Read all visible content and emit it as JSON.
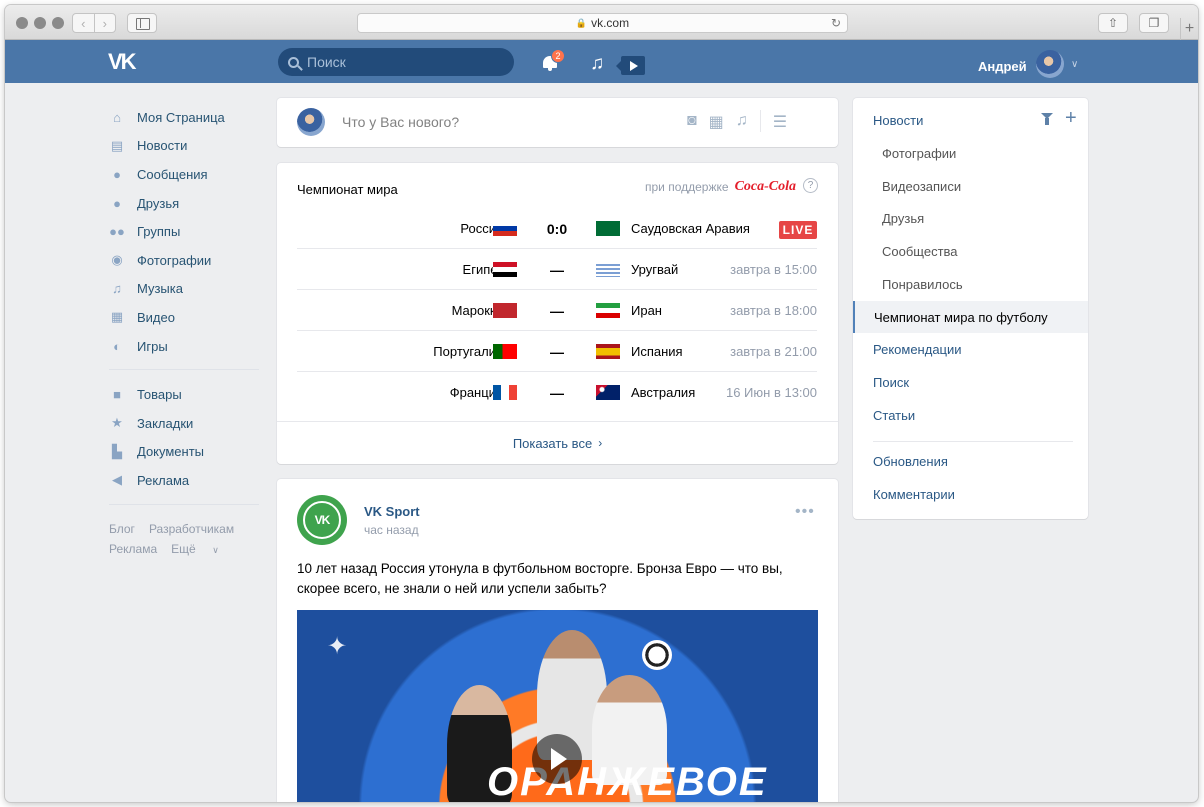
{
  "browser": {
    "url": "vk.com"
  },
  "header": {
    "search_placeholder": "Поиск",
    "notifications_count": "2",
    "user_name": "Андрей"
  },
  "left_menu": {
    "items": [
      {
        "label": "Моя Страница",
        "icon": "home-icon"
      },
      {
        "label": "Новости",
        "icon": "news-icon"
      },
      {
        "label": "Сообщения",
        "icon": "messages-icon"
      },
      {
        "label": "Друзья",
        "icon": "friends-icon"
      },
      {
        "label": "Группы",
        "icon": "groups-icon"
      },
      {
        "label": "Фотографии",
        "icon": "camera-icon"
      },
      {
        "label": "Музыка",
        "icon": "music-icon"
      },
      {
        "label": "Видео",
        "icon": "video-icon"
      },
      {
        "label": "Игры",
        "icon": "gamepad-icon"
      }
    ],
    "items2": [
      {
        "label": "Товары",
        "icon": "bag-icon"
      },
      {
        "label": "Закладки",
        "icon": "star-icon"
      },
      {
        "label": "Документы",
        "icon": "document-icon"
      },
      {
        "label": "Реклама",
        "icon": "megaphone-icon"
      }
    ],
    "footer": [
      "Блог",
      "Разработчикам",
      "Реклама",
      "Ещё"
    ]
  },
  "post_box": {
    "placeholder": "Что у Вас нового?"
  },
  "world_cup": {
    "title": "Чемпионат мира",
    "sponsor_text": "при поддержке",
    "sponsor_brand": "Coca-Cola",
    "help": "?",
    "matches": [
      {
        "home": "Россия",
        "away": "Саудовская Аравия",
        "score": "0:0",
        "status": "LIVE"
      },
      {
        "home": "Египет",
        "away": "Уругвай",
        "score": "—",
        "time": "завтра в 15:00"
      },
      {
        "home": "Марокко",
        "away": "Иран",
        "score": "—",
        "time": "завтра в 18:00"
      },
      {
        "home": "Португалия",
        "away": "Испания",
        "score": "—",
        "time": "завтра в 21:00"
      },
      {
        "home": "Франция",
        "away": "Австралия",
        "score": "—",
        "time": "16 Июн в 13:00"
      }
    ],
    "show_all": "Показать все"
  },
  "post": {
    "author": "VK Sport",
    "time": "час назад",
    "text": "10 лет назад Россия утонула в футбольном восторге. Бронза Евро — что вы, скорее всего, не знали о ней или успели забыть?",
    "image_title": "ОРАНЖЕВОЕ"
  },
  "right_menu": {
    "news": "Новости",
    "subs": [
      "Фотографии",
      "Видеозаписи",
      "Друзья",
      "Сообщества",
      "Понравилось"
    ],
    "active": "Чемпионат мира по футболу",
    "links": [
      "Рекомендации",
      "Поиск",
      "Статьи"
    ],
    "bottom": [
      "Обновления",
      "Комментарии"
    ]
  },
  "colors": {
    "vk_blue": "#4a76a8",
    "link": "#2a5885",
    "live": "#e64646"
  }
}
